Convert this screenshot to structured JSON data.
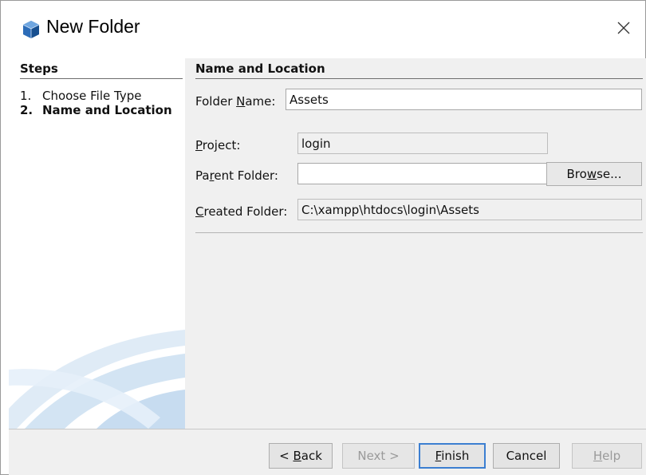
{
  "window": {
    "title": "New Folder",
    "close_glyph": "×"
  },
  "steps": {
    "heading": "Steps",
    "items": [
      {
        "number": "1.",
        "label": "Choose File Type",
        "current": false
      },
      {
        "number": "2.",
        "label": "Name and Location",
        "current": true
      }
    ]
  },
  "content": {
    "heading": "Name and Location",
    "folder_name": {
      "label_pre": "Folder ",
      "label_mnemonic": "N",
      "label_post": "ame:",
      "value": "Assets"
    },
    "project": {
      "label_pre": "",
      "label_mnemonic": "P",
      "label_post": "roject:",
      "value": "login"
    },
    "parent_folder": {
      "label_pre": "Pa",
      "label_mnemonic": "r",
      "label_post": "ent Folder:",
      "value": ""
    },
    "browse": {
      "pre": "Bro",
      "mnemonic": "w",
      "post": "se..."
    },
    "created_folder": {
      "label_pre": "",
      "label_mnemonic": "C",
      "label_post": "reated Folder:",
      "value": "C:\\xampp\\htdocs\\login\\Assets"
    }
  },
  "footer": {
    "back": {
      "pre": "< ",
      "mnemonic": "B",
      "post": "ack",
      "enabled": true
    },
    "next": {
      "label": "Next >",
      "enabled": false
    },
    "finish": {
      "pre": "",
      "mnemonic": "F",
      "post": "inish",
      "enabled": true
    },
    "cancel": {
      "label": "Cancel",
      "enabled": true
    },
    "help": {
      "pre": "",
      "mnemonic": "H",
      "post": "elp",
      "enabled": false
    }
  },
  "colors": {
    "accent": "#3c7fd1",
    "panel_bg": "#f0f0f0",
    "icon_blue": "#1f5fa8"
  },
  "icons": {
    "app": "netbeans-cube-icon",
    "close": "close-icon",
    "watermark": "netbeans-swoosh-watermark"
  }
}
